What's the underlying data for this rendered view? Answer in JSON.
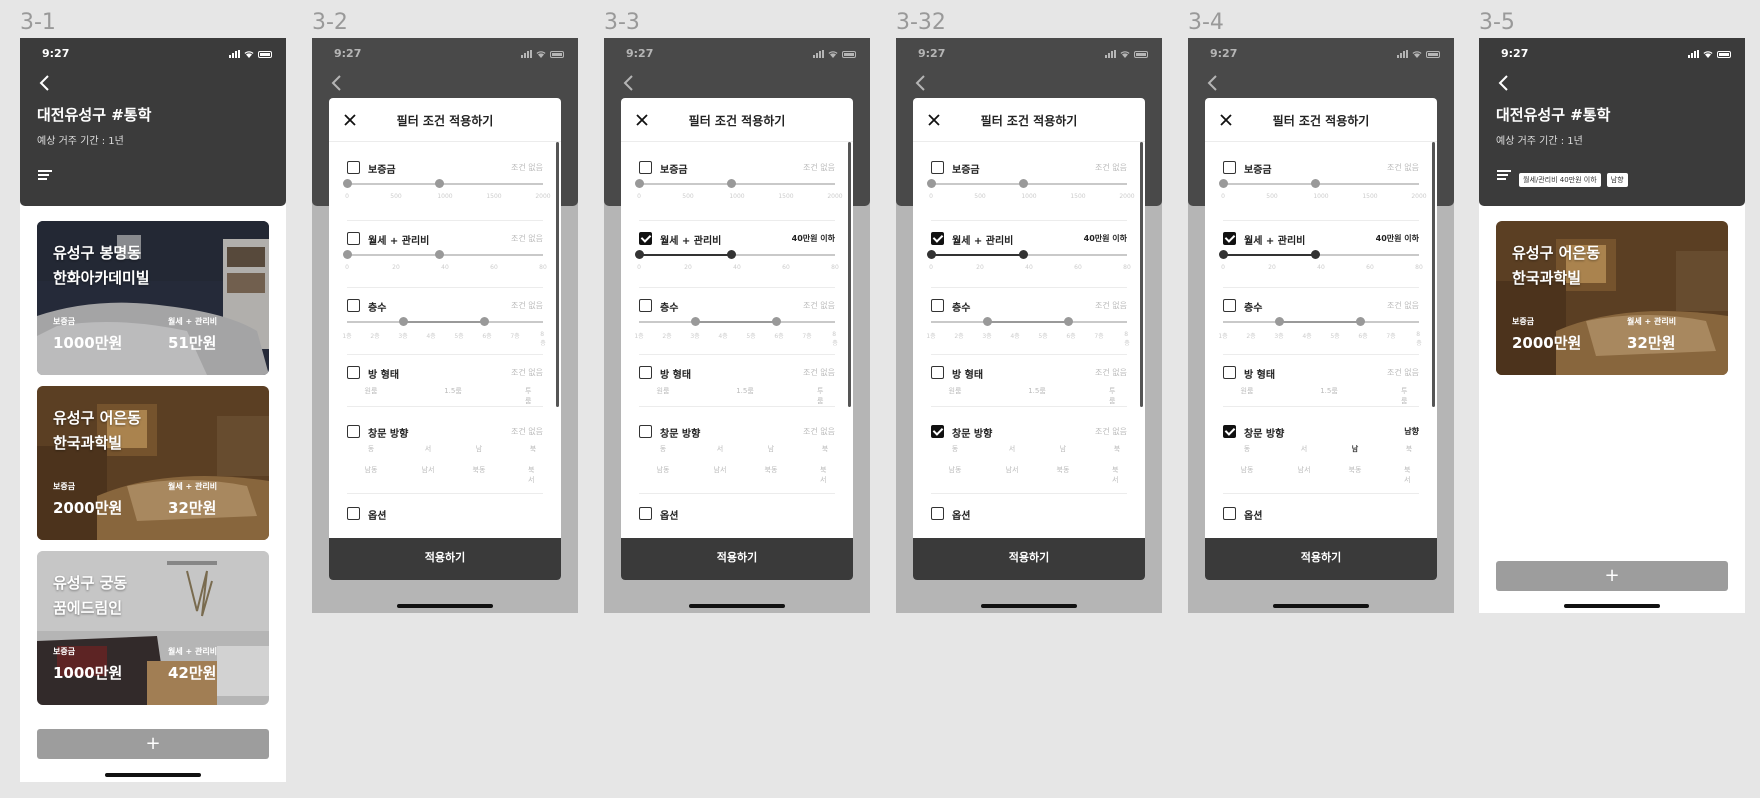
{
  "frames": [
    "3-1",
    "3-2",
    "3-3",
    "3-32",
    "3-4",
    "3-5"
  ],
  "status": {
    "time": "9:27"
  },
  "header": {
    "title": "대전유성구 #통학",
    "subtitle": "예상 거주 기간 : 1년"
  },
  "listing_labels": {
    "deposit": "보증금",
    "rent": "월세 + 관리비"
  },
  "listings": [
    {
      "line1": "유성구 봉명동",
      "line2": "한화아카데미빌",
      "deposit": "1000만원",
      "rent": "51만원"
    },
    {
      "line1": "유성구 어은동",
      "line2": "한국과학빌",
      "deposit": "2000만원",
      "rent": "32만원"
    },
    {
      "line1": "유성구 궁동",
      "line2": "꿈에드림인",
      "deposit": "1000만원",
      "rent": "42만원"
    }
  ],
  "add_button": "+",
  "modal": {
    "title": "필터 조건 적용하기",
    "apply": "적용하기",
    "no_condition": "조건 없음",
    "sections": {
      "deposit": "보증금",
      "rent": "월세 + 관리비",
      "floor": "층수",
      "room_type": "방 형태",
      "window": "창문 방향",
      "option": "옵션"
    },
    "deposit_ticks": [
      "0",
      "500",
      "1000",
      "1500",
      "2000"
    ],
    "rent_ticks": [
      "0",
      "20",
      "40",
      "60",
      "80"
    ],
    "floor_ticks": [
      "1층",
      "2층",
      "3층",
      "4층",
      "5층",
      "6층",
      "7층",
      "8층"
    ],
    "room_types": [
      "원룸",
      "1.5룸",
      "투룸"
    ],
    "windows_row1": [
      "동",
      "서",
      "남",
      "북"
    ],
    "windows_row2": [
      "남동",
      "남서",
      "북동",
      "북서"
    ],
    "rent_selected": "40만원 이하",
    "window_selected": "남향"
  },
  "result": {
    "chips": [
      "월세/관리비 40만원 이하",
      "남향"
    ],
    "listing": {
      "line1": "유성구 어은동",
      "line2": "한국과학빌",
      "deposit": "2000만원",
      "rent": "32만원"
    }
  }
}
